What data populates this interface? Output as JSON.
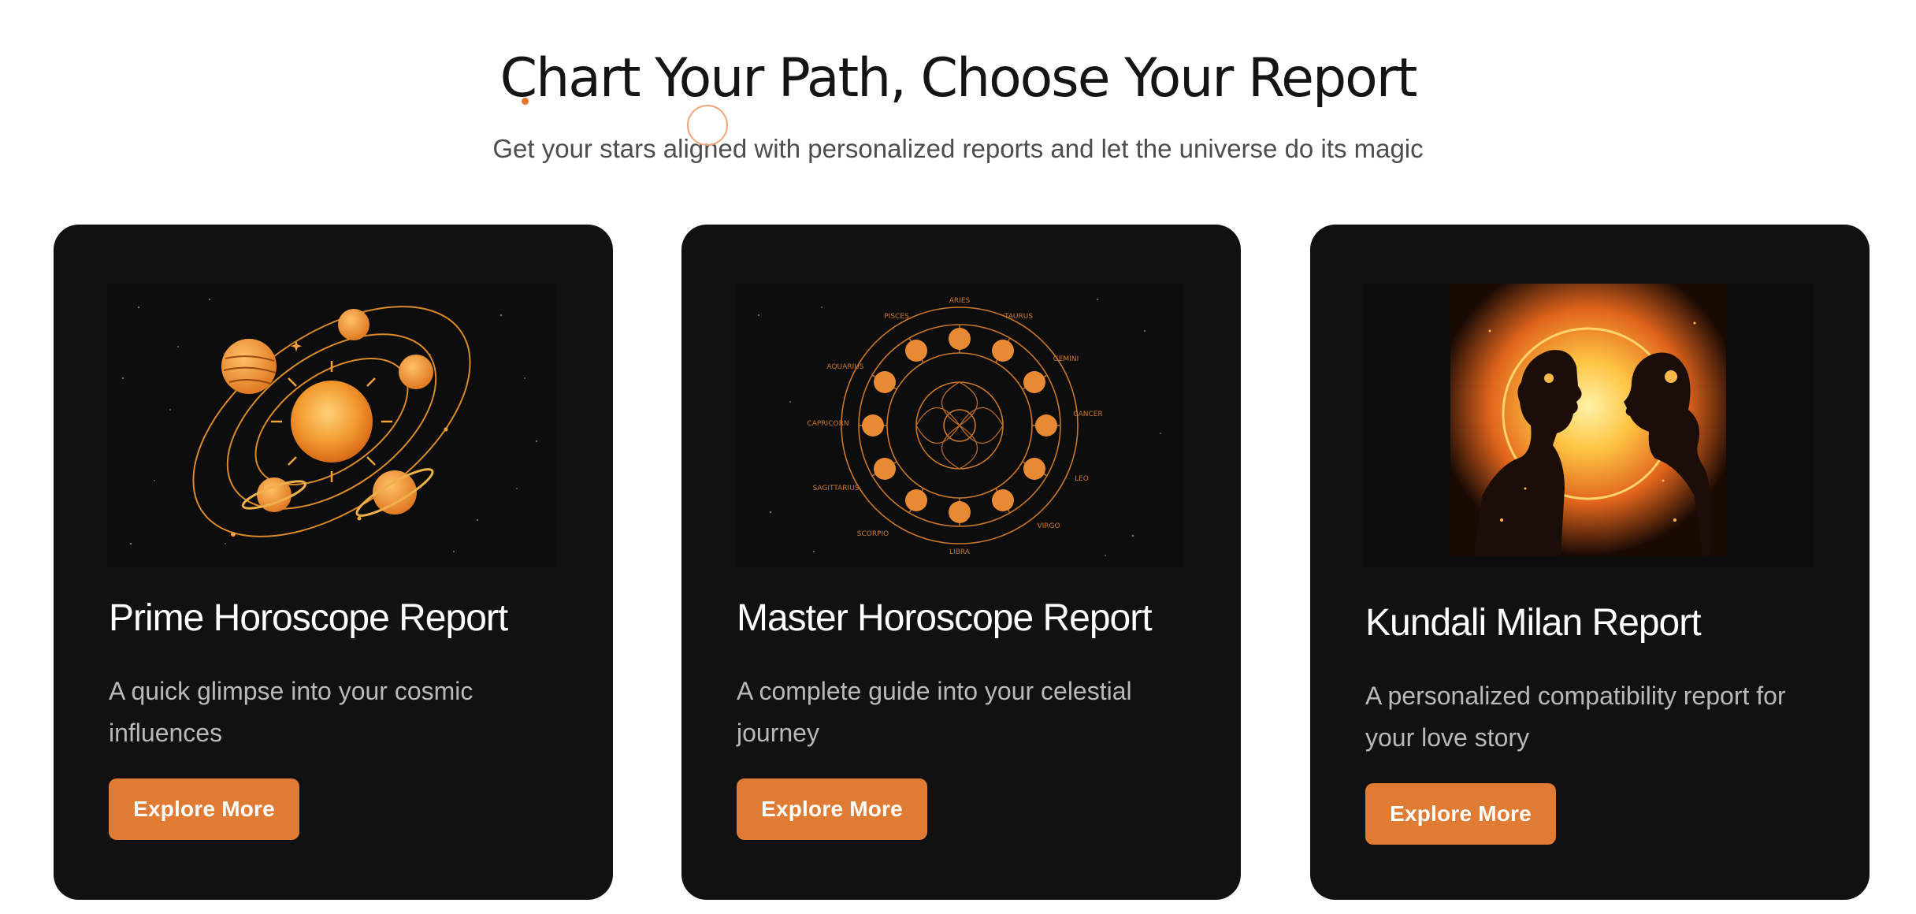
{
  "header": {
    "title": "Chart Your Path, Choose Your Report",
    "subtitle": "Get your stars aligned with personalized reports and let the universe do its magic"
  },
  "cards": [
    {
      "title": "Prime Horoscope Report",
      "description": "A quick glimpse into your cosmic influences",
      "button_label": "Explore More",
      "image": "solar-system-illustration"
    },
    {
      "title": "Master Horoscope Report",
      "description": "A complete guide into your celestial journey",
      "button_label": "Explore More",
      "image": "zodiac-wheel-illustration",
      "zodiac_labels": [
        "ARIES",
        "TAURUS",
        "GEMINI",
        "CANCER",
        "LEO",
        "VIRGO",
        "LIBRA",
        "SCORPIO",
        "SAGITTARIUS",
        "CAPRICORN",
        "AQUARIUS",
        "PISCES"
      ]
    },
    {
      "title": "Kundali Milan Report",
      "description": "A personalized compatibility report for your love story",
      "button_label": "Explore More",
      "image": "couple-silhouette-illustration"
    }
  ],
  "colors": {
    "accent": "#e07b34",
    "card_background": "#111111",
    "title_text": "#141414",
    "subtitle_text": "#4d4d4d"
  }
}
